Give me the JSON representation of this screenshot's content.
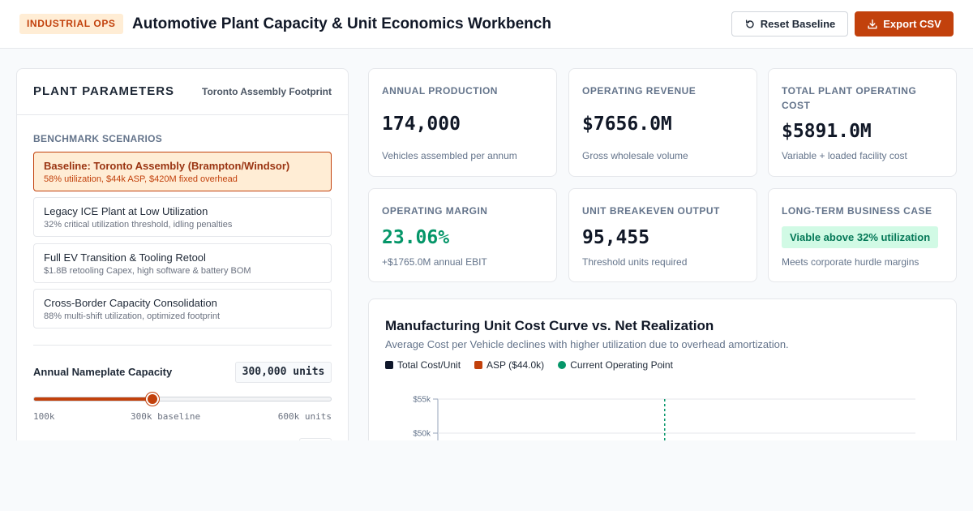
{
  "header": {
    "badge": "INDUSTRIAL OPS",
    "title": "Automotive Plant Capacity & Unit Economics Workbench",
    "reset_label": "Reset Baseline",
    "export_label": "Export CSV"
  },
  "panel": {
    "title": "PLANT PARAMETERS",
    "subtitle": "Toronto Assembly Footprint",
    "scenarios_label": "BENCHMARK SCENARIOS",
    "scenarios": [
      {
        "title": "Baseline: Toronto Assembly (Brampton/Windsor)",
        "desc": "58% utilization, $44k ASP, $420M fixed overhead",
        "active": true
      },
      {
        "title": "Legacy ICE Plant at Low Utilization",
        "desc": "32% critical utilization threshold, idling penalties",
        "active": false
      },
      {
        "title": "Full EV Transition & Tooling Retool",
        "desc": "$1.8B retooling Capex, high software & battery BOM",
        "active": false
      },
      {
        "title": "Cross-Border Capacity Consolidation",
        "desc": "88% multi-shift utilization, optimized footprint",
        "active": false
      }
    ],
    "capacity": {
      "label": "Annual Nameplate Capacity",
      "value_text": "300,000 units",
      "slider_fraction": 0.4,
      "tick_min": "100k",
      "tick_mid": "300k baseline",
      "tick_max": "600k units"
    }
  },
  "kpis": {
    "production": {
      "label": "ANNUAL PRODUCTION",
      "value": "174,000",
      "note": "Vehicles assembled per annum"
    },
    "revenue": {
      "label": "OPERATING REVENUE",
      "value": "$7656.0M",
      "note": "Gross wholesale volume"
    },
    "cost": {
      "label": "TOTAL PLANT OPERATING COST",
      "value": "$5891.0M",
      "note": "Variable + loaded facility cost"
    },
    "margin": {
      "label": "OPERATING MARGIN",
      "value": "23.06%",
      "note": "+$1765.0M annual EBIT"
    },
    "breakeven": {
      "label": "UNIT BREAKEVEN OUTPUT",
      "value": "95,455",
      "note": "Threshold units required"
    },
    "business_case": {
      "label": "LONG-TERM BUSINESS CASE",
      "badge": "Viable above 32% utilization",
      "note": "Meets corporate hurdle margins"
    }
  },
  "colors": {
    "accent": "#c2410c",
    "cost_series": "#0f172a",
    "asp_series": "#c2410c",
    "operating_point": "#059669"
  },
  "chart_data": {
    "type": "line",
    "title": "Manufacturing Unit Cost Curve vs. Net Realization",
    "subtitle": "Average Cost per Vehicle declines with higher utilization due to overhead amortization.",
    "legend": [
      "Total Cost/Unit",
      "ASP ($44.0k)",
      "Current Operating Point"
    ],
    "y_ticks": [
      "$55k",
      "$50k"
    ],
    "ylim_visible": [
      50000,
      55000
    ],
    "operating_point_fraction": 0.475,
    "grid": true
  }
}
